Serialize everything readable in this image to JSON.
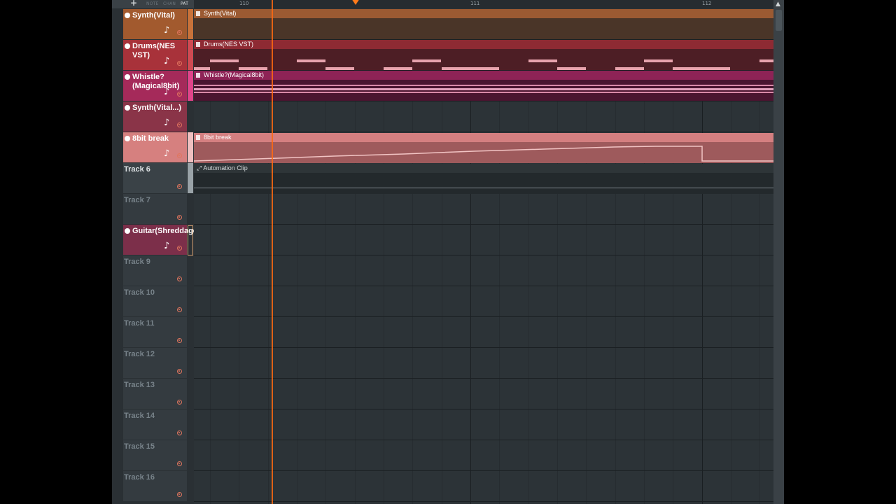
{
  "toolbar": {
    "add_label": "+",
    "modes": [
      "NOTE",
      "CHAN",
      "PAT"
    ],
    "active_mode": "PAT"
  },
  "ruler": {
    "bars": [
      "110",
      "111",
      "112"
    ]
  },
  "tracks": [
    {
      "name": "Synth(Vital)",
      "kind": "instrument",
      "color": "#a25a2e"
    },
    {
      "name": "Drums(NES VST)",
      "kind": "instrument",
      "color": "#a8323a"
    },
    {
      "name": "Whistle?(Magical8bit)",
      "kind": "instrument",
      "color": "#a52a5a"
    },
    {
      "name": "Synth(Vital...)",
      "kind": "instrument",
      "color": "#8a3448"
    },
    {
      "name": "8bit break",
      "kind": "instrument",
      "color": "#d6807f"
    },
    {
      "name": "Track 6",
      "kind": "plain",
      "color": "#3a4247"
    },
    {
      "name": "Track 7",
      "kind": "empty",
      "color": "#343b40"
    },
    {
      "name": "Guitar(Shreddage)",
      "kind": "instrument",
      "color": "#7c2f4a"
    },
    {
      "name": "Track 9",
      "kind": "empty",
      "color": "#343b40"
    },
    {
      "name": "Track 10",
      "kind": "empty",
      "color": "#343b40"
    },
    {
      "name": "Track 11",
      "kind": "empty",
      "color": "#343b40"
    },
    {
      "name": "Track 12",
      "kind": "empty",
      "color": "#343b40"
    },
    {
      "name": "Track 13",
      "kind": "empty",
      "color": "#343b40"
    },
    {
      "name": "Track 14",
      "kind": "empty",
      "color": "#343b40"
    },
    {
      "name": "Track 15",
      "kind": "empty",
      "color": "#343b40"
    },
    {
      "name": "Track 16",
      "kind": "empty",
      "color": "#343b40"
    }
  ],
  "clips": {
    "synth_vital": "Synth(Vital)",
    "drums": "Drums(NES VST)",
    "whistle": "Whistle?(Magical8bit)",
    "break": "8bit break",
    "automation": "Automation Clip"
  },
  "playhead_bar_position": 110.35
}
